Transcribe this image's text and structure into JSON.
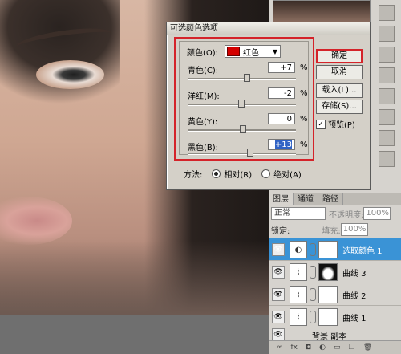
{
  "dialog": {
    "title": "可选颜色选项",
    "colors_label": "颜色(O):",
    "colors_value": "红色",
    "colors_swatch": "#d40000",
    "sliders": [
      {
        "label": "青色(C):",
        "value": "+7",
        "unit": "%",
        "position": 0.54
      },
      {
        "label": "洋红(M):",
        "value": "-2",
        "unit": "%",
        "position": 0.49
      },
      {
        "label": "黄色(Y):",
        "value": "0",
        "unit": "%",
        "position": 0.5
      },
      {
        "label": "黑色(B):",
        "value": "+13",
        "unit": "%",
        "position": 0.57
      }
    ],
    "buttons": {
      "ok": "确定",
      "cancel": "取消",
      "load": "载入(L)...",
      "save": "存储(S)..."
    },
    "preview_label": "预览(P)",
    "preview_checked": true,
    "method_label": "方法:",
    "method_relative": "相对(R)",
    "method_absolute": "绝对(A)",
    "method_selected": "relative"
  },
  "layers_panel": {
    "tabs": [
      "图层",
      "通道",
      "路径"
    ],
    "blend_mode": "正常",
    "opacity_label": "不透明度:",
    "opacity_value": "100%",
    "lock_label": "锁定:",
    "fill_label": "填充:",
    "fill_value": "100%",
    "layers": [
      {
        "name": "选取颜色 1",
        "active": true,
        "type": "adjustment"
      },
      {
        "name": "曲线 3",
        "active": false,
        "type": "curves-masked"
      },
      {
        "name": "曲线 2",
        "active": false,
        "type": "curves"
      },
      {
        "name": "曲线 1",
        "active": false,
        "type": "curves"
      },
      {
        "name": "背景 副本",
        "active": false,
        "type": "image"
      }
    ]
  }
}
